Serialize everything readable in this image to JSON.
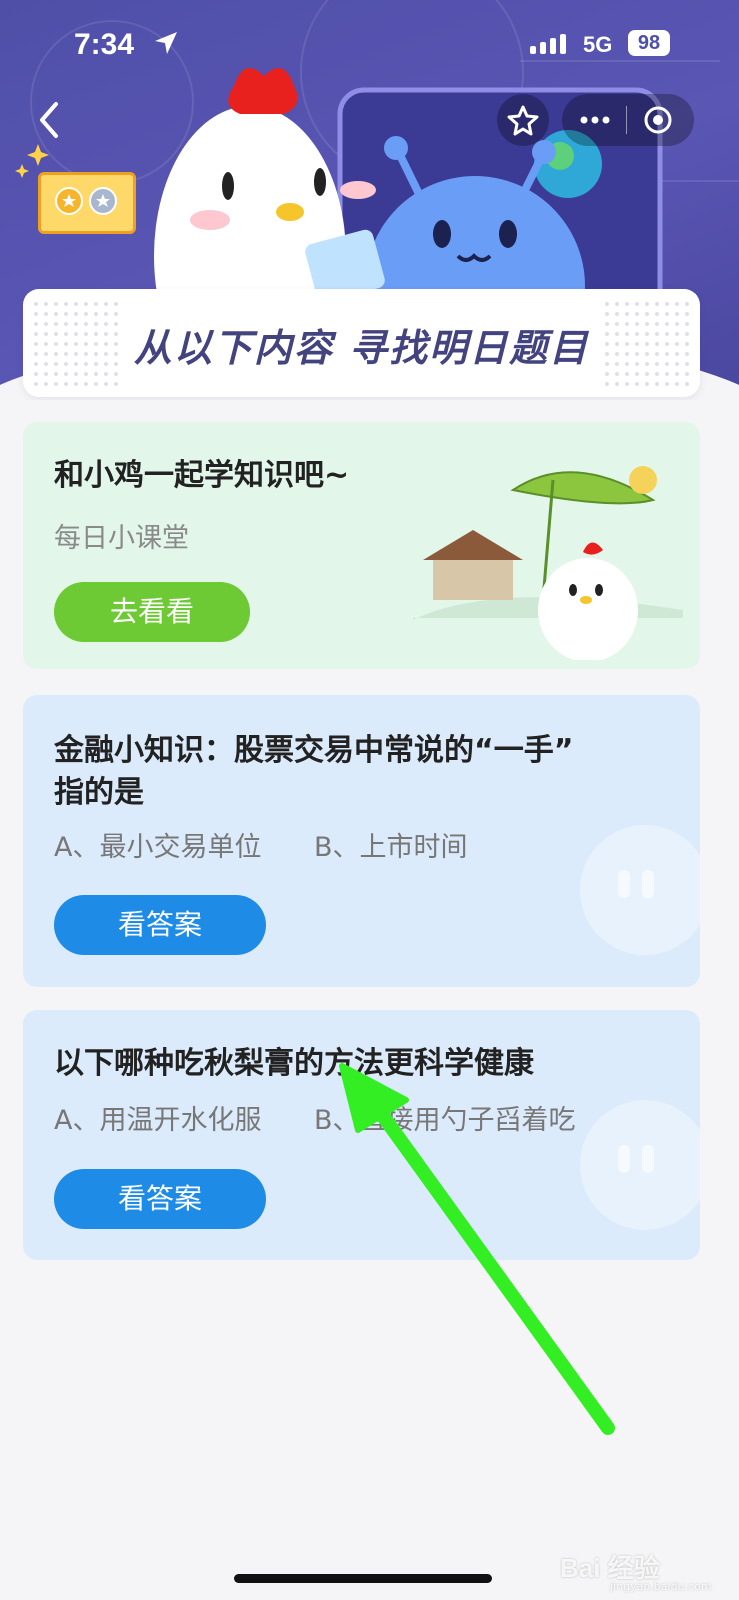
{
  "status_bar": {
    "time": "7:34",
    "network": "5G",
    "battery": "98"
  },
  "nav": {
    "back_icon": "chevron-left-icon",
    "favorite_icon": "star-icon",
    "more_icon": "more-dots-icon",
    "close_icon": "target-circle-icon"
  },
  "banner": {
    "search_text": "从以下内容 寻找明日题目"
  },
  "cards": [
    {
      "title": "和小鸡一起学知识吧~",
      "subtitle": "每日小课堂",
      "button": "去看看"
    },
    {
      "title_line1": "金融小知识：股票交易中常说的“一手”",
      "title_line2": "指的是",
      "option_a": "A、最小交易单位",
      "option_b": "B、上市时间",
      "button": "看答案"
    },
    {
      "title": "以下哪种吃秋梨膏的方法更科学健康",
      "option_a": "A、用温开水化服",
      "option_b": "B、直接用勺子舀着吃",
      "button": "看答案"
    }
  ],
  "watermark": {
    "brand": "Bai 经验",
    "url": "jingyan.baidu.com"
  },
  "colors": {
    "header": "#5a56b4",
    "card_green": "#e3f6ea",
    "card_blue": "#dcebfb",
    "button_green": "#6dca35",
    "button_blue": "#1e8ce6",
    "annotation_arrow": "#33ee22"
  }
}
